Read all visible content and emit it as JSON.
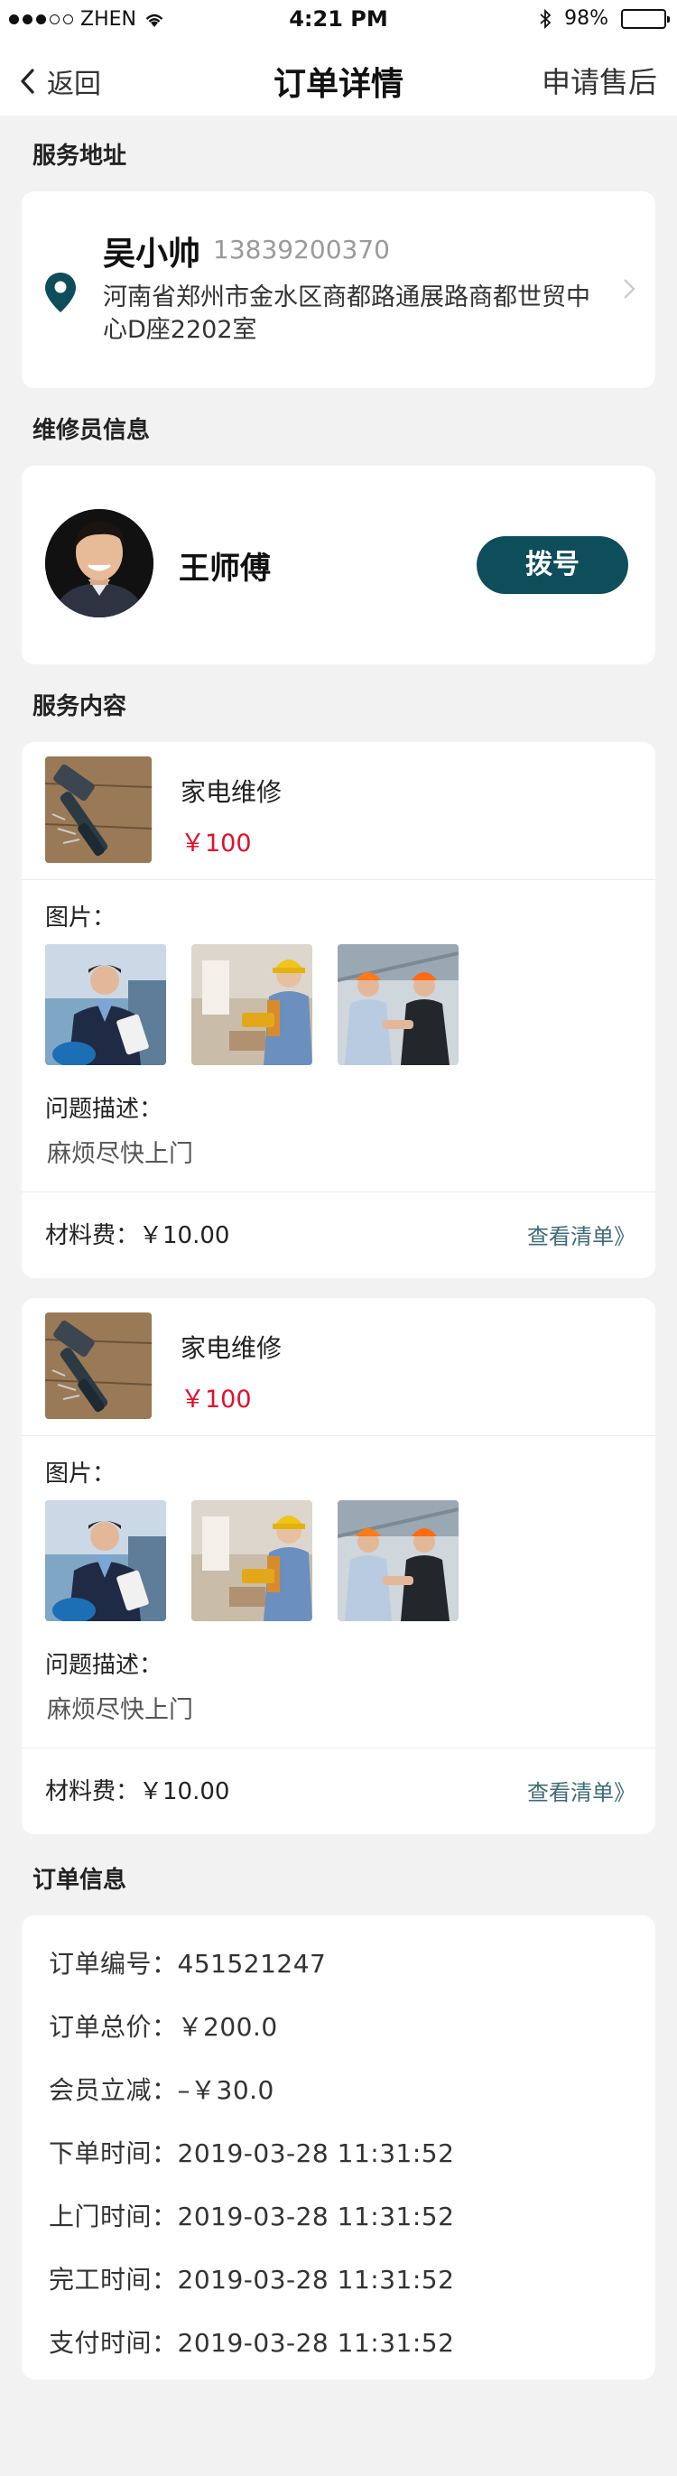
{
  "status_bar": {
    "carrier": "ZHEN",
    "time": "4:21 PM",
    "battery": "98%",
    "battery_level": 0.98
  },
  "nav": {
    "back_label": "返回",
    "title": "订单详情",
    "right_action": "申请售后"
  },
  "address_section": {
    "title": "服务地址",
    "name": "吴小帅",
    "phone": "13839200370",
    "address": "河南省郑州市金水区商都路通展路商都世贸中心D座2202室"
  },
  "worker_section": {
    "title": "维修员信息",
    "name": "王师傅",
    "call_label": "拨号"
  },
  "service_section": {
    "title": "服务内容",
    "items": [
      {
        "name": "家电维修",
        "price": "￥100",
        "photos_label": "图片：",
        "desc_label": "问题描述：",
        "desc": "麻烦尽快上门",
        "fee": "材料费：￥10.00",
        "list_link": "查看清单》"
      },
      {
        "name": "家电维修",
        "price": "￥100",
        "photos_label": "图片：",
        "desc_label": "问题描述：",
        "desc": "麻烦尽快上门",
        "fee": "材料费：￥10.00",
        "list_link": "查看清单》"
      }
    ]
  },
  "order_section": {
    "title": "订单信息",
    "rows": [
      {
        "label": "订单编号：",
        "value": "451521247"
      },
      {
        "label": "订单总价：",
        "value": "￥200.0"
      },
      {
        "label": "会员立减：",
        "value": "–￥30.0"
      },
      {
        "label": "下单时间：",
        "value": "2019-03-28 11:31:52"
      },
      {
        "label": "上门时间：",
        "value": "2019-03-28 11:31:52"
      },
      {
        "label": "完工时间：",
        "value": "2019-03-28 11:31:52"
      },
      {
        "label": "支付时间：",
        "value": "2019-03-28 11:31:52"
      }
    ]
  },
  "colors": {
    "accent": "#0e4d5a",
    "price": "#e0102c",
    "background": "#f2f2f2",
    "link": "#3f6b76"
  },
  "icons": [
    "signal-dots-icon",
    "wifi-icon",
    "bluetooth-icon",
    "battery-icon",
    "back-chevron-icon",
    "location-pin-icon",
    "chevron-right-icon"
  ]
}
